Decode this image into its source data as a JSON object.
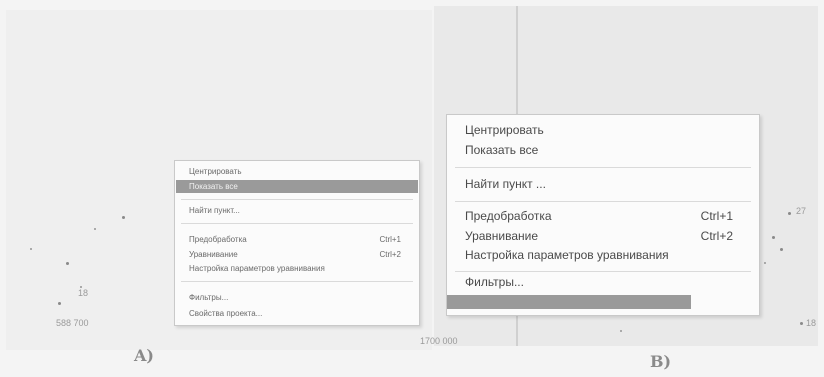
{
  "menu_a": {
    "items": [
      {
        "label": "Центрировать"
      },
      {
        "label": "Показать все"
      },
      {
        "label": "Найти пункт..."
      },
      {
        "label": "Предобработка",
        "shortcut": "Ctrl+1"
      },
      {
        "label": "Уравнивание",
        "shortcut": "Ctrl+2"
      },
      {
        "label": "Настройка параметров уравнивания"
      },
      {
        "label": "Фильтры..."
      },
      {
        "label": "Свойства проекта..."
      }
    ]
  },
  "menu_b": {
    "items": [
      {
        "label": "Центрировать"
      },
      {
        "label": "Показать все"
      },
      {
        "label": "Найти пункт ..."
      },
      {
        "label": "Предобработка",
        "shortcut": "Ctrl+1"
      },
      {
        "label": "Уравнивание",
        "shortcut": "Ctrl+2"
      },
      {
        "label": "Настройка параметров уравнивания"
      },
      {
        "label": "Фильтры..."
      }
    ]
  },
  "plot_labels": {
    "a_18": "18",
    "a_coord": "588 700",
    "a_bottom": "1700 000",
    "b_27": "27",
    "b_18": "18"
  },
  "captions": {
    "a": "A)",
    "b": "B)"
  },
  "colors": {
    "highlight": "#9a9a9a",
    "background": "#efefef",
    "menu_bg": "#fbfbfb"
  }
}
